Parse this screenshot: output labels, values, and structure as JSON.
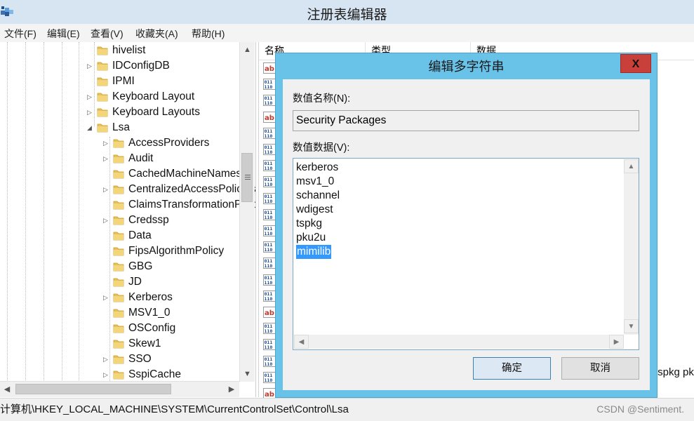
{
  "window": {
    "title": "注册表编辑器"
  },
  "menu": [
    "文件(F)",
    "编辑(E)",
    "查看(V)",
    "收藏夹(A)",
    "帮助(H)"
  ],
  "tree": {
    "items": [
      {
        "label": "hivelist",
        "level": 0,
        "expander": "none"
      },
      {
        "label": "IDConfigDB",
        "level": 0,
        "expander": "collapsed"
      },
      {
        "label": "IPMI",
        "level": 0,
        "expander": "none"
      },
      {
        "label": "Keyboard Layout",
        "level": 0,
        "expander": "collapsed"
      },
      {
        "label": "Keyboard Layouts",
        "level": 0,
        "expander": "collapsed"
      },
      {
        "label": "Lsa",
        "level": 0,
        "expander": "expanded"
      },
      {
        "label": "AccessProviders",
        "level": 1,
        "expander": "collapsed"
      },
      {
        "label": "Audit",
        "level": 1,
        "expander": "collapsed"
      },
      {
        "label": "CachedMachineNames",
        "level": 1,
        "expander": "none"
      },
      {
        "label": "CentralizedAccessPolicies",
        "level": 1,
        "expander": "collapsed"
      },
      {
        "label": "ClaimsTransformationPolicies",
        "level": 1,
        "expander": "none"
      },
      {
        "label": "Credssp",
        "level": 1,
        "expander": "collapsed"
      },
      {
        "label": "Data",
        "level": 1,
        "expander": "none"
      },
      {
        "label": "FipsAlgorithmPolicy",
        "level": 1,
        "expander": "none"
      },
      {
        "label": "GBG",
        "level": 1,
        "expander": "none"
      },
      {
        "label": "JD",
        "level": 1,
        "expander": "none"
      },
      {
        "label": "Kerberos",
        "level": 1,
        "expander": "collapsed"
      },
      {
        "label": "MSV1_0",
        "level": 1,
        "expander": "none"
      },
      {
        "label": "OSConfig",
        "level": 1,
        "expander": "none"
      },
      {
        "label": "Skew1",
        "level": 1,
        "expander": "none"
      },
      {
        "label": "SSO",
        "level": 1,
        "expander": "collapsed"
      },
      {
        "label": "SspiCache",
        "level": 1,
        "expander": "collapsed"
      }
    ]
  },
  "values": {
    "columns": [
      "名称",
      "类型",
      "数据"
    ],
    "icons": [
      "ab",
      "bin",
      "bin",
      "ab",
      "bin",
      "bin",
      "bin",
      "bin",
      "bin",
      "bin",
      "bin",
      "bin",
      "bin",
      "bin",
      "bin",
      "ab",
      "bin",
      "bin",
      "bin",
      "bin",
      "ab"
    ],
    "trailing_text": "tspkg pk"
  },
  "statusbar": {
    "path": "计算机\\HKEY_LOCAL_MACHINE\\SYSTEM\\CurrentControlSet\\Control\\Lsa",
    "watermark": "CSDN @Sentiment."
  },
  "dialog": {
    "title": "编辑多字符串",
    "close_label": "X",
    "name_label": "数值名称(N):",
    "name_value": "Security Packages",
    "data_label": "数值数据(V):",
    "data_lines": [
      "kerberos",
      "msv1_0",
      "schannel",
      "wdigest",
      "tspkg",
      "pku2u",
      "mimilib"
    ],
    "selected_line": "mimilib",
    "ok_label": "确定",
    "cancel_label": "取消"
  },
  "colors": {
    "title_bar": "#d7e4f2",
    "dialog_frame": "#69c2e8",
    "close_button": "#c9403a",
    "selection": "#3399ff"
  }
}
